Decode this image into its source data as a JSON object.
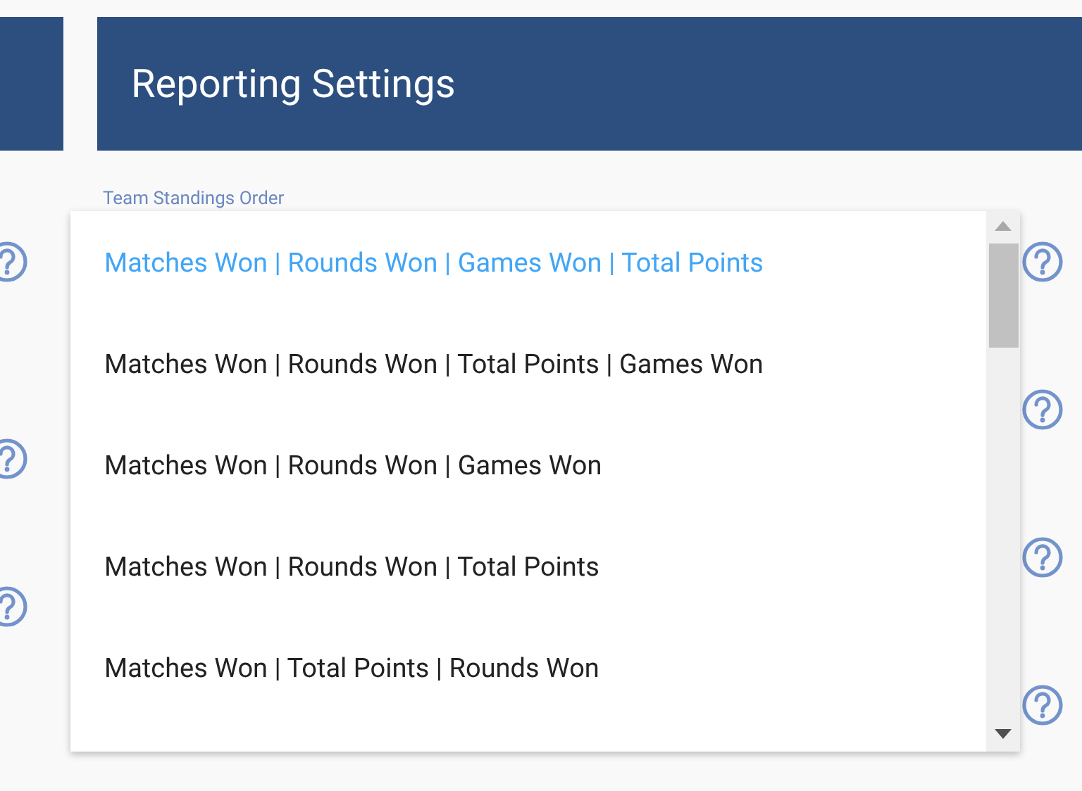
{
  "header": {
    "title": "Reporting Settings"
  },
  "field": {
    "label": "Team Standings Order"
  },
  "dropdown": {
    "options": [
      {
        "label": "Matches Won | Rounds Won | Games Won | Total Points",
        "selected": true
      },
      {
        "label": "Matches Won | Rounds Won | Total Points | Games Won",
        "selected": false
      },
      {
        "label": "Matches Won | Rounds Won | Games Won",
        "selected": false
      },
      {
        "label": "Matches Won | Rounds Won | Total Points",
        "selected": false
      },
      {
        "label": "Matches Won | Total Points | Rounds Won",
        "selected": false
      }
    ]
  }
}
